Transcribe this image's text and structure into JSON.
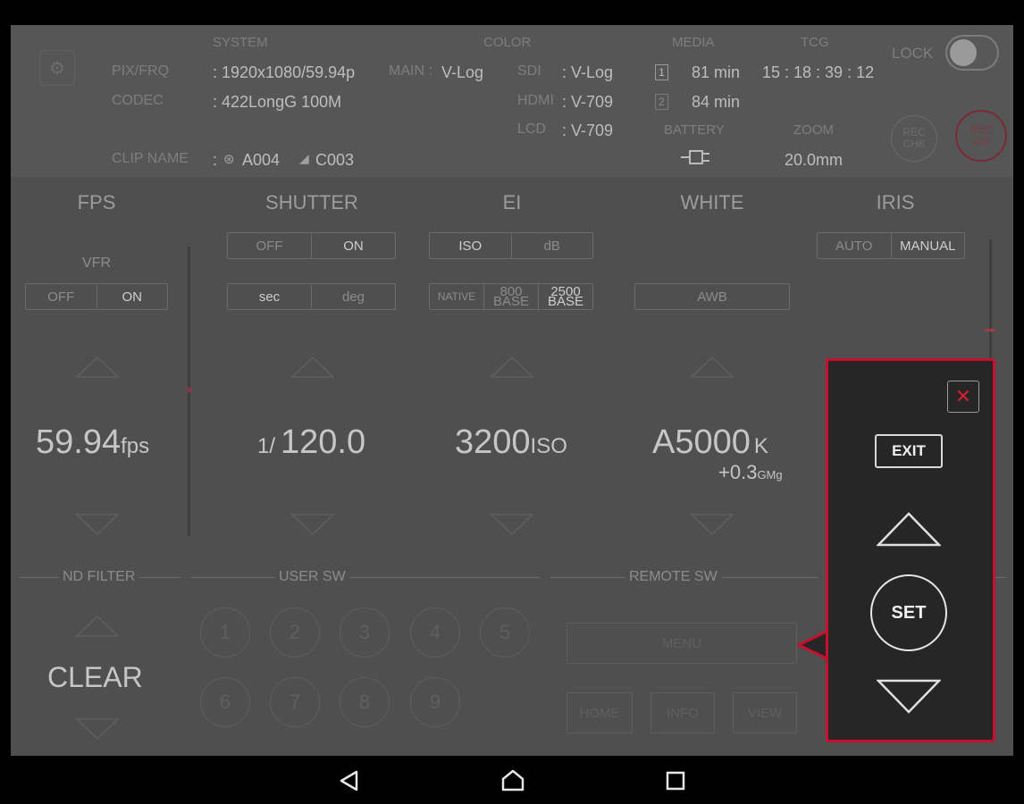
{
  "header": {
    "system_label": "SYSTEM",
    "color_label": "COLOR",
    "media_label": "MEDIA",
    "tcg_label": "TCG",
    "pixfrq_label": "PIX/FRQ",
    "pixfrq_value": ": 1920x1080/59.94p",
    "codec_label": "CODEC",
    "codec_value": ": 422LongG 100M",
    "clip_label": "CLIP NAME",
    "clip_sep": ":",
    "clip_a": "A004",
    "clip_c": "C003",
    "main_label": "MAIN :",
    "main_value": "V-Log",
    "sdi_label": "SDI",
    "sdi_value": ": V-Log",
    "hdmi_label": "HDMI",
    "hdmi_value": ": V-709",
    "lcd_label": "LCD",
    "lcd_value": ": V-709",
    "media1_num": "1",
    "media1_value": "81 min",
    "media2_num": "2",
    "media2_value": "84 min",
    "tcg_value": "15 : 18 : 39 : 12",
    "battery_label": "BATTERY",
    "zoom_label": "ZOOM",
    "zoom_value": "20.0mm",
    "lock_label": "LOCK",
    "rec_chk": "REC\nCHK",
    "rec_ss": "REC\nS/S"
  },
  "fps": {
    "title": "FPS",
    "vfr_label": "VFR",
    "off": "OFF",
    "on": "ON",
    "value": "59.94",
    "unit": "fps"
  },
  "shutter": {
    "title": "SHUTTER",
    "off": "OFF",
    "on": "ON",
    "sec": "sec",
    "deg": "deg",
    "prefix": "1/",
    "value": "120.0"
  },
  "ei": {
    "title": "EI",
    "iso": "ISO",
    "db": "dB",
    "native": "NATIVE",
    "base800_a": "800",
    "base800_b": "BASE",
    "base2500_a": "2500",
    "base2500_b": "BASE",
    "value": "3200",
    "unit": "ISO"
  },
  "white": {
    "title": "WHITE",
    "awb": "AWB",
    "value": "A5000",
    "unit": "K",
    "sub_value": "+0.3",
    "sub_unit": "GMg"
  },
  "iris": {
    "title": "IRIS",
    "auto": "AUTO",
    "manual": "MANUAL"
  },
  "nd": {
    "title": "ND FILTER",
    "value": "CLEAR"
  },
  "user_sw": {
    "title": "USER SW",
    "buttons": [
      "1",
      "2",
      "3",
      "4",
      "5",
      "6",
      "7",
      "8",
      "9"
    ]
  },
  "remote_sw": {
    "title": "REMOTE SW",
    "menu": "MENU",
    "home": "HOME",
    "info": "INFO",
    "view": "VIEW"
  },
  "menu_panel": {
    "exit": "EXIT",
    "set": "SET",
    "close_glyph": "✕"
  },
  "colors": {
    "accent_red": "#c8102e",
    "background": "#4f4f4f",
    "panel_bg": "#262626"
  }
}
